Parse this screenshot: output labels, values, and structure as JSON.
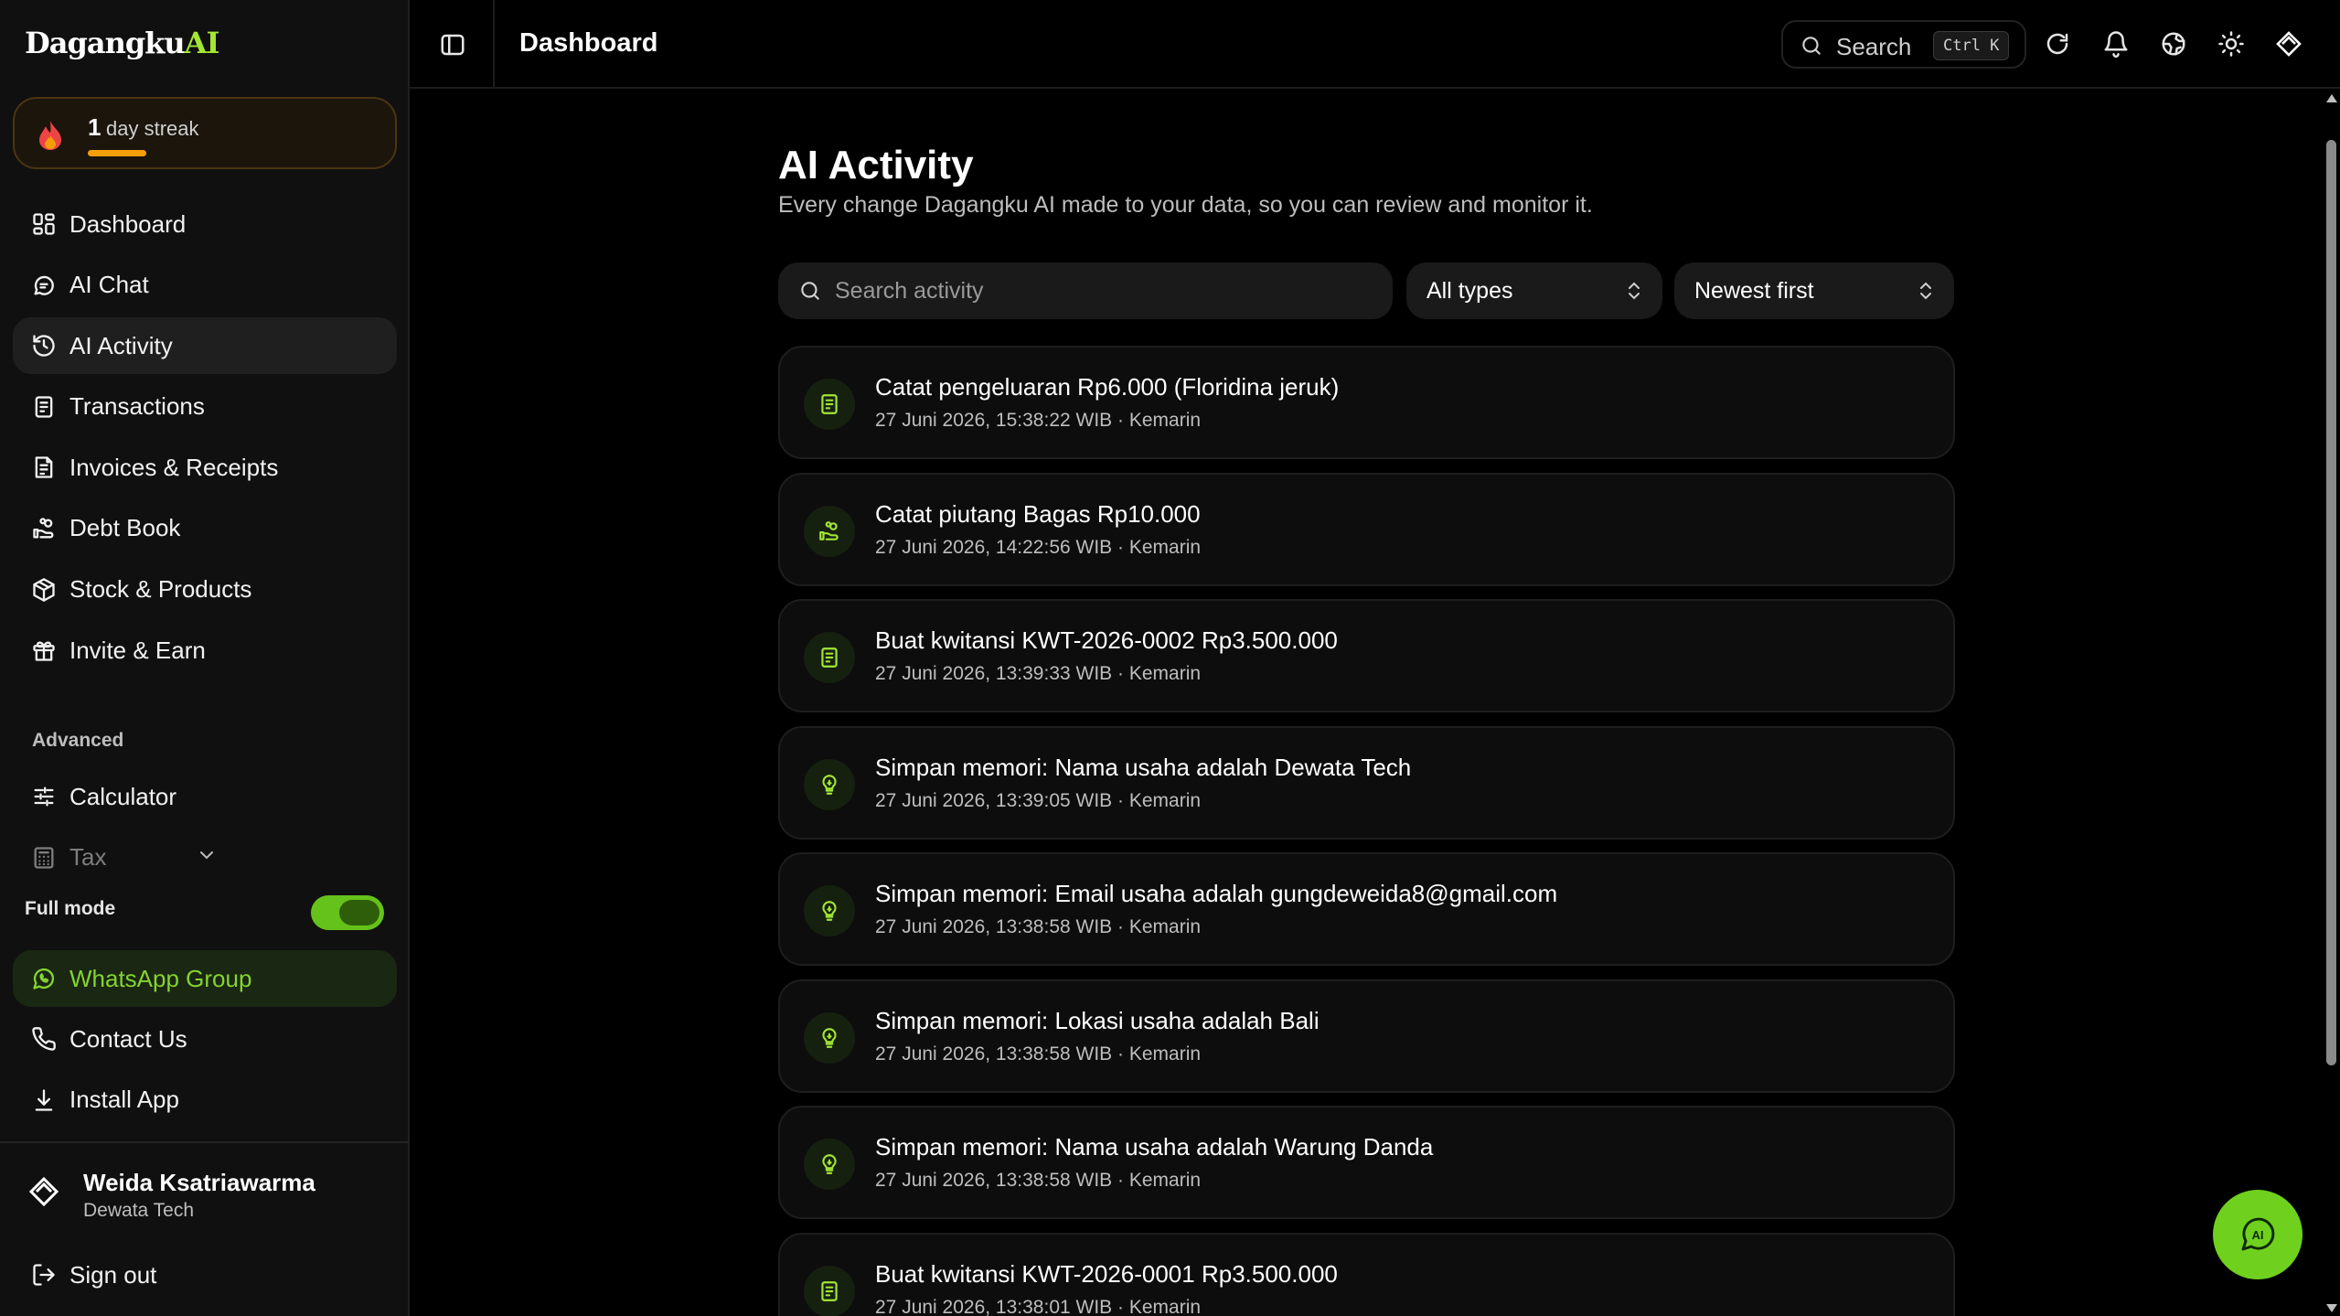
{
  "brand": {
    "name": "Dagangku",
    "suffix": "AI"
  },
  "streak": {
    "count": "1",
    "label": "day streak",
    "progress_fraction": 0.2
  },
  "sidebar": {
    "items": [
      {
        "label": "Dashboard",
        "icon": "grid-icon"
      },
      {
        "label": "AI Chat",
        "icon": "chat-icon"
      },
      {
        "label": "AI Activity",
        "icon": "history-icon",
        "active": true
      },
      {
        "label": "Transactions",
        "icon": "receipt-icon"
      },
      {
        "label": "Invoices & Receipts",
        "icon": "invoice-icon"
      },
      {
        "label": "Debt Book",
        "icon": "hand-coins-icon"
      },
      {
        "label": "Stock & Products",
        "icon": "package-icon"
      },
      {
        "label": "Invite & Earn",
        "icon": "gift-icon"
      }
    ],
    "section_advanced": "Advanced",
    "advanced_items": [
      {
        "label": "Calculator",
        "icon": "sliders-icon"
      },
      {
        "label": "Tax",
        "icon": "calculator-icon"
      }
    ],
    "full_mode_label": "Full mode",
    "full_mode_on": true,
    "whatsapp_label": "WhatsApp Group",
    "contact_label": "Contact Us",
    "install_label": "Install App",
    "user": {
      "name": "Weida Ksatriawarma",
      "org": "Dewata Tech"
    },
    "signout_label": "Sign out"
  },
  "topbar": {
    "title": "Dashboard",
    "search_label": "Search",
    "search_shortcut": "Ctrl K",
    "icons": [
      "refresh-icon",
      "bell-icon",
      "globe-icon",
      "sun-icon",
      "logo-icon"
    ]
  },
  "main": {
    "heading": "AI Activity",
    "subtitle": "Every change Dagangku AI made to your data, so you can review and monitor it.",
    "search_placeholder": "Search activity",
    "type_filter": "All types",
    "sort": "Newest first",
    "activities": [
      {
        "title": "Catat pengeluaran Rp6.000 (Floridina jeruk)",
        "meta": "27 Juni 2026, 15:38:22 WIB · Kemarin",
        "icon": "receipt-icon"
      },
      {
        "title": "Catat piutang Bagas Rp10.000",
        "meta": "27 Juni 2026, 14:22:56 WIB · Kemarin",
        "icon": "hand-coins-icon"
      },
      {
        "title": "Buat kwitansi KWT-2026-0002 Rp3.500.000",
        "meta": "27 Juni 2026, 13:39:33 WIB · Kemarin",
        "icon": "receipt-icon"
      },
      {
        "title": "Simpan memori: Nama usaha adalah Dewata Tech",
        "meta": "27 Juni 2026, 13:39:05 WIB · Kemarin",
        "icon": "lightbulb-icon"
      },
      {
        "title": "Simpan memori: Email usaha adalah gungdeweida8@gmail.com",
        "meta": "27 Juni 2026, 13:38:58 WIB · Kemarin",
        "icon": "lightbulb-icon"
      },
      {
        "title": "Simpan memori: Lokasi usaha adalah Bali",
        "meta": "27 Juni 2026, 13:38:58 WIB · Kemarin",
        "icon": "lightbulb-icon"
      },
      {
        "title": "Simpan memori: Nama usaha adalah Warung Danda",
        "meta": "27 Juni 2026, 13:38:58 WIB · Kemarin",
        "icon": "lightbulb-icon"
      },
      {
        "title": "Buat kwitansi KWT-2026-0001 Rp3.500.000",
        "meta": "27 Juni 2026, 13:38:01 WIB · Kemarin",
        "icon": "receipt-icon"
      }
    ]
  },
  "colors": {
    "accent": "#a3e635",
    "streak": "#f59e0b",
    "whatsapp": "#84d330",
    "fab": "#6fd11e"
  }
}
